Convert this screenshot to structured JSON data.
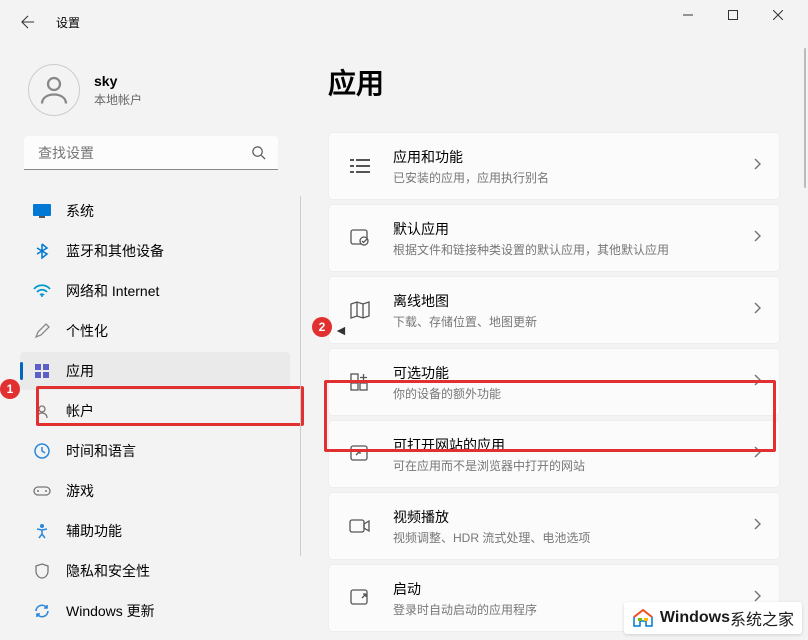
{
  "titlebar": {
    "app_title": "设置"
  },
  "user": {
    "name": "sky",
    "type": "本地帐户"
  },
  "search": {
    "placeholder": "查找设置"
  },
  "sidebar": {
    "items": [
      {
        "label": "系统"
      },
      {
        "label": "蓝牙和其他设备"
      },
      {
        "label": "网络和 Internet"
      },
      {
        "label": "个性化"
      },
      {
        "label": "应用"
      },
      {
        "label": "帐户"
      },
      {
        "label": "时间和语言"
      },
      {
        "label": "游戏"
      },
      {
        "label": "辅助功能"
      },
      {
        "label": "隐私和安全性"
      },
      {
        "label": "Windows 更新"
      }
    ]
  },
  "page": {
    "title": "应用"
  },
  "settings": [
    {
      "title": "应用和功能",
      "desc": "已安装的应用，应用执行别名"
    },
    {
      "title": "默认应用",
      "desc": "根据文件和链接种类设置的默认应用，其他默认应用"
    },
    {
      "title": "离线地图",
      "desc": "下载、存储位置、地图更新"
    },
    {
      "title": "可选功能",
      "desc": "你的设备的额外功能"
    },
    {
      "title": "可打开网站的应用",
      "desc": "可在应用而不是浏览器中打开的网站"
    },
    {
      "title": "视频播放",
      "desc": "视频调整、HDR 流式处理、电池选项"
    },
    {
      "title": "启动",
      "desc": "登录时自动启动的应用程序"
    }
  ],
  "badges": {
    "b1": "1",
    "b2": "2"
  },
  "watermark": {
    "brand": "Windows",
    "sub": " 系统之家"
  }
}
